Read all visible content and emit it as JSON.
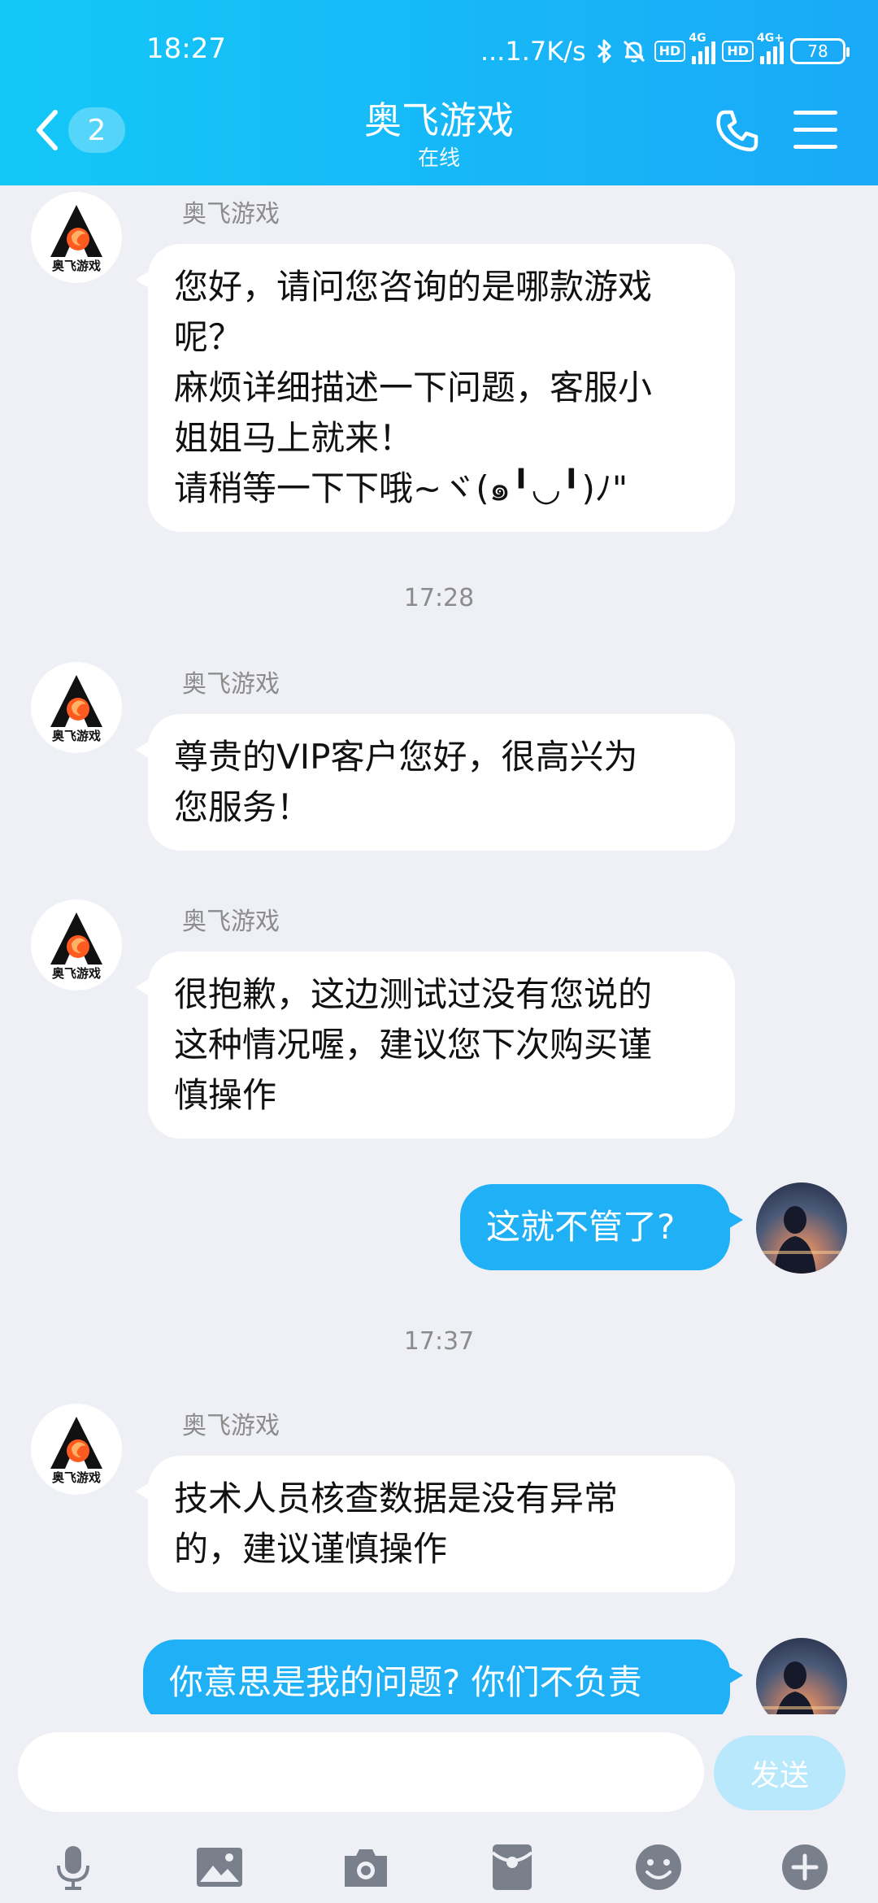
{
  "status_bar": {
    "time": "18:27",
    "network_speed": "...1.7K/s",
    "hd1": "HD",
    "net1": "4G",
    "hd2": "HD",
    "net2": "4G+",
    "battery": "78"
  },
  "header": {
    "unread_count": "2",
    "title": "奥飞游戏",
    "subtitle": "在线"
  },
  "logo_text": "奥飞游戏",
  "messages": [
    {
      "sender": "奥飞游戏",
      "lines": [
        "您好，请问您咨询的是哪款游戏",
        "呢？",
        "麻烦详细描述一下问题，客服小",
        "姐姐马上就来！",
        "请稍等一下下哦~ヾ(๑╹◡╹)ﾉ\""
      ]
    },
    {
      "timestamp": "17:28"
    },
    {
      "sender": "奥飞游戏",
      "lines": [
        "尊贵的VIP客户您好，很高兴为",
        "您服务！"
      ]
    },
    {
      "sender": "奥飞游戏",
      "lines": [
        "很抱歉，这边测试过没有您说的",
        "这种情况喔，建议您下次购买谨",
        "慎操作"
      ]
    },
    {
      "from_me": true,
      "lines": [
        "这就不管了?"
      ]
    },
    {
      "timestamp": "17:37"
    },
    {
      "sender": "奥飞游戏",
      "lines": [
        "技术人员核查数据是没有异常",
        "的，建议谨慎操作"
      ]
    },
    {
      "from_me": true,
      "lines": [
        "你意思是我的问题? 你们不负责"
      ]
    }
  ],
  "input": {
    "placeholder": "",
    "send_label": "发送"
  },
  "toolbar": [
    "microphone-icon",
    "image-icon",
    "camera-icon",
    "red-packet-icon",
    "emoji-icon",
    "plus-icon"
  ],
  "colors": {
    "header_start": "#13c8f7",
    "header_end": "#1aa9f7",
    "outgoing_bubble": "#20b0f5",
    "background": "#eef0f6"
  }
}
